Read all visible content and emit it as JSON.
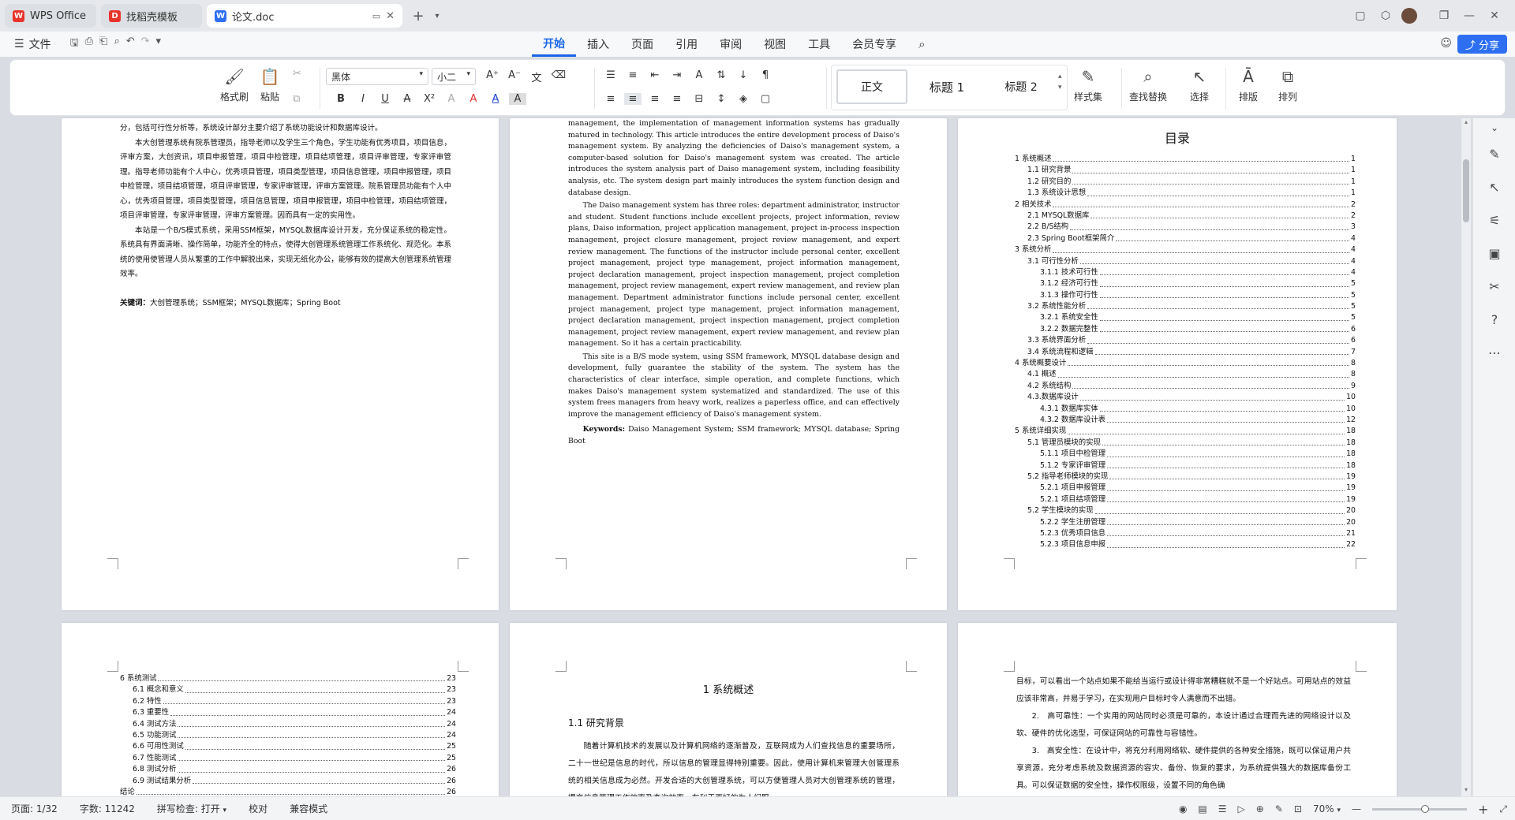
{
  "tabs": [
    {
      "label": "WPS Office",
      "icon": "W",
      "color": "#e8342b"
    },
    {
      "label": "找稻壳模板",
      "icon": "D",
      "color": "#e8342b"
    },
    {
      "label": "论文.doc",
      "icon": "W",
      "color": "#2e6ff2"
    }
  ],
  "menu": {
    "file": "文件",
    "items": [
      "开始",
      "插入",
      "页面",
      "引用",
      "审阅",
      "视图",
      "工具",
      "会员专享"
    ],
    "share": "分享"
  },
  "ribbon": {
    "format_painter": "格式刷",
    "paste": "粘贴",
    "font": "黑体",
    "size": "小二",
    "styles": [
      "正文",
      "标题 1",
      "标题 2"
    ],
    "style_set": "样式集",
    "find_replace": "查找替换",
    "select": "选择",
    "layout": "排版",
    "arrange": "排列"
  },
  "page1": {
    "lines": [
      "分，包括可行性分析等，系统设计部分主要介绍了系统功能设计和数据库设计。",
      "本大创管理系统有院系管理员，指导老师以及学生三个角色，学生功能有优秀项目，项目信息，评审方案，大创资讯，项目申报管理，项目中检管理，项目结项管理，项目评审管理，专家评审管理。指导老师功能有个人中心，优秀项目管理，项目类型管理，项目信息管理，项目申报管理，项目中检管理，项目结项管理，项目评审管理，专家评审管理，评审方案管理。院系管理员功能有个人中心，优秀项目管理，项目类型管理，项目信息管理，项目申报管理，项目中检管理，项目结项管理，项目评审管理，专家评审管理，评审方案管理。因而具有一定的实用性。",
      "本站是一个B/S模式系统，采用SSM框架，MYSQL数据库设计开发，充分保证系统的稳定性。系统具有界面清晰、操作简单，功能齐全的特点，使得大创管理系统管理工作系统化、规范化。本系统的使用使管理人员从繁重的工作中解脱出来，实现无纸化办公，能够有效的提高大创管理系统管理效率。"
    ],
    "keywords_label": "关键词：",
    "keywords": "大创管理系统；SSM框架；MYSQL数据库；Spring Boot"
  },
  "page2": {
    "paras": [
      "management, the implementation of management information systems has gradually matured in technology. This article introduces the entire development process of Daiso's management system. By analyzing the deficiencies of Daiso's management system, a computer-based solution for Daiso's management system was created. The article introduces the system analysis part of Daiso management system, including feasibility analysis, etc. The system design part mainly introduces the system function design and database design.",
      "The Daiso management system has three roles: department administrator, instructor and student. Student functions include excellent projects, project information, review plans, Daiso information, project application management, project in-process inspection management, project closure management, project review management, and expert review management. The functions of the instructor include personal center, excellent project management, project type management, project information management, project declaration management, project inspection management, project completion management, project review management, expert review management, and review plan management. Department administrator functions include personal center, excellent project management, project type management, project information management, project declaration management, project inspection management, project completion management, project review management, expert review management, and review plan management. So it has a certain practicability.",
      "This site is a B/S mode system, using SSM framework, MYSQL database design and development, fully guarantee the stability of the system. The system has the characteristics of clear interface, simple operation, and complete functions, which makes Daiso's management system systematized and standardized. The use of this system frees managers from heavy work, realizes a paperless office, and can effectively improve the management efficiency of Daiso's management system."
    ],
    "keywords_label": "Keywords:",
    "keywords": " Daiso Management System; SSM framework; MYSQL database; Spring Boot"
  },
  "toc": {
    "title": "目录",
    "entries": [
      {
        "t": "1 系统概述",
        "p": "1",
        "l": 0
      },
      {
        "t": "1.1 研究背景",
        "p": "1",
        "l": 1
      },
      {
        "t": "1.2 研究目的",
        "p": "1",
        "l": 1
      },
      {
        "t": "1.3 系统设计思想",
        "p": "1",
        "l": 1
      },
      {
        "t": "2 相关技术",
        "p": "2",
        "l": 0
      },
      {
        "t": "2.1 MYSQL数据库",
        "p": "2",
        "l": 1
      },
      {
        "t": "2.2 B/S结构",
        "p": "3",
        "l": 1
      },
      {
        "t": "2.3 Spring Boot框架简介",
        "p": "4",
        "l": 1
      },
      {
        "t": "3 系统分析",
        "p": "4",
        "l": 0
      },
      {
        "t": "3.1 可行性分析",
        "p": "4",
        "l": 1
      },
      {
        "t": "3.1.1 技术可行性",
        "p": "4",
        "l": 2
      },
      {
        "t": "3.1.2 经济可行性",
        "p": "5",
        "l": 2
      },
      {
        "t": "3.1.3 操作可行性",
        "p": "5",
        "l": 2
      },
      {
        "t": "3.2 系统性能分析",
        "p": "5",
        "l": 1
      },
      {
        "t": "3.2.1 系统安全性",
        "p": "5",
        "l": 2
      },
      {
        "t": "3.2.2 数据完整性",
        "p": "6",
        "l": 2
      },
      {
        "t": "3.3 系统界面分析",
        "p": "6",
        "l": 1
      },
      {
        "t": "3.4 系统流程和逻辑",
        "p": "7",
        "l": 1
      },
      {
        "t": "4 系统概要设计",
        "p": "8",
        "l": 0
      },
      {
        "t": "4.1 概述",
        "p": "8",
        "l": 1
      },
      {
        "t": "4.2 系统结构",
        "p": "9",
        "l": 1
      },
      {
        "t": "4.3.数据库设计",
        "p": "10",
        "l": 1
      },
      {
        "t": "4.3.1 数据库实体",
        "p": "10",
        "l": 2
      },
      {
        "t": "4.3.2 数据库设计表",
        "p": "12",
        "l": 2
      },
      {
        "t": "5 系统详细实现",
        "p": "18",
        "l": 0
      },
      {
        "t": "5.1 管理员模块的实现",
        "p": "18",
        "l": 1
      },
      {
        "t": "5.1.1 项目中检管理",
        "p": "18",
        "l": 2
      },
      {
        "t": "5.1.2 专家评审管理",
        "p": "18",
        "l": 2
      },
      {
        "t": "5.2 指导老师模块的实现",
        "p": "19",
        "l": 1
      },
      {
        "t": "5.2.1 项目申报管理",
        "p": "19",
        "l": 2
      },
      {
        "t": "5.2.1 项目结项管理",
        "p": "19",
        "l": 2
      },
      {
        "t": "5.2 学生模块的实现",
        "p": "20",
        "l": 1
      },
      {
        "t": "5.2.2 学生注册管理",
        "p": "20",
        "l": 2
      },
      {
        "t": "5.2.3 优秀项目信息",
        "p": "21",
        "l": 2
      },
      {
        "t": "5.2.3 项目信息申报",
        "p": "22",
        "l": 2
      }
    ]
  },
  "toc2": [
    {
      "t": "6 系统测试",
      "p": "23",
      "l": 0
    },
    {
      "t": "6.1 概念和意义",
      "p": "23",
      "l": 1
    },
    {
      "t": "6.2 特性",
      "p": "23",
      "l": 1
    },
    {
      "t": "6.3 重要性",
      "p": "24",
      "l": 1
    },
    {
      "t": "6.4 测试方法",
      "p": "24",
      "l": 1
    },
    {
      "t": "6.5  功能测试",
      "p": "24",
      "l": 1
    },
    {
      "t": "6.6 可用性测试",
      "p": "25",
      "l": 1
    },
    {
      "t": "6.7 性能测试",
      "p": "25",
      "l": 1
    },
    {
      "t": "6.8 测试分析",
      "p": "26",
      "l": 1
    },
    {
      "t": "6.9 测试结果分析",
      "p": "26",
      "l": 1
    },
    {
      "t": "结论",
      "p": "26",
      "l": 0
    }
  ],
  "page5": {
    "chapter": "1 系统概述",
    "section": "1.1  研究背景",
    "text": "随着计算机技术的发展以及计算机网络的逐渐普及，互联网成为人们查找信息的重要场所，二十一世纪是信息的时代，所以信息的管理显得特别重要。因此，使用计算机来管理大创管理系统的相关信息成为必然。开发合适的大创管理系统，可以方便管理人员对大创管理系统的管理，提高信息管理工作效率及查询效率，有利于更好的为人们服"
  },
  "page6": {
    "lines": [
      "目标，可以看出一个站点如果不能给当运行或设计得非常糟糕就不是一个好站点。可用站点的效益应该非常高，并易于学习，在实现用户目标时令人满意而不出错。",
      "2.　高可靠性：一个实用的网站同时必须是可靠的，本设计通过合理而先进的网络设计以及软、硬件的优化选型，可保证网站的可靠性与容错性。",
      "3.　高安全性：在设计中，将充分利用网络软、硬件提供的各种安全措施，既可以保证用户共享资源，充分考虑系统及数据资源的容灾、备份、恢复的要求，为系统提供强大的数据库备份工具。可以保证数据的安全性，操作权限级，设置不同的角色确"
    ]
  },
  "status": {
    "page": "页面: 1/32",
    "words": "字数: 11242",
    "spell": "拼写检查: 打开",
    "proof": "校对",
    "compat": "兼容模式",
    "zoom": "70%"
  }
}
